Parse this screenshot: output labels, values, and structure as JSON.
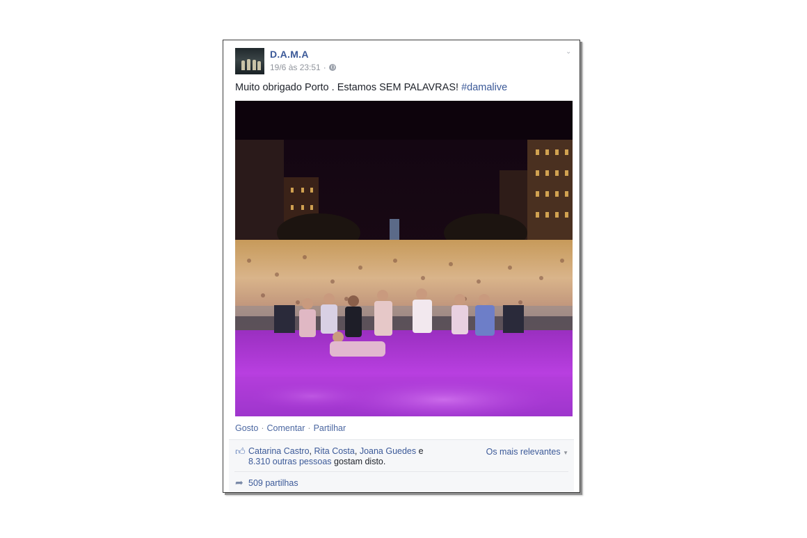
{
  "post": {
    "page_name": "D.A.M.A",
    "timestamp": "19/6 às 23:51",
    "timestamp_sep": "·",
    "text": "Muito obrigado Porto . Estamos SEM PALAVRAS!",
    "hashtag": "#damalive",
    "photo_icon": "concert-photo"
  },
  "actions": {
    "like": "Gosto",
    "comment": "Comentar",
    "share": "Partilhar",
    "sep": "·"
  },
  "likes": {
    "names": [
      "Catarina Castro",
      "Rita Costa",
      "Joana Guedes"
    ],
    "conjunction": "e",
    "others": "8.310 outras pessoas",
    "suffix": "gostam disto."
  },
  "sort_label": "Os mais relevantes",
  "shares_label": "509 partilhas",
  "colors": {
    "link": "#3b5998",
    "meta": "#90949c",
    "stage": "#c040e0"
  }
}
